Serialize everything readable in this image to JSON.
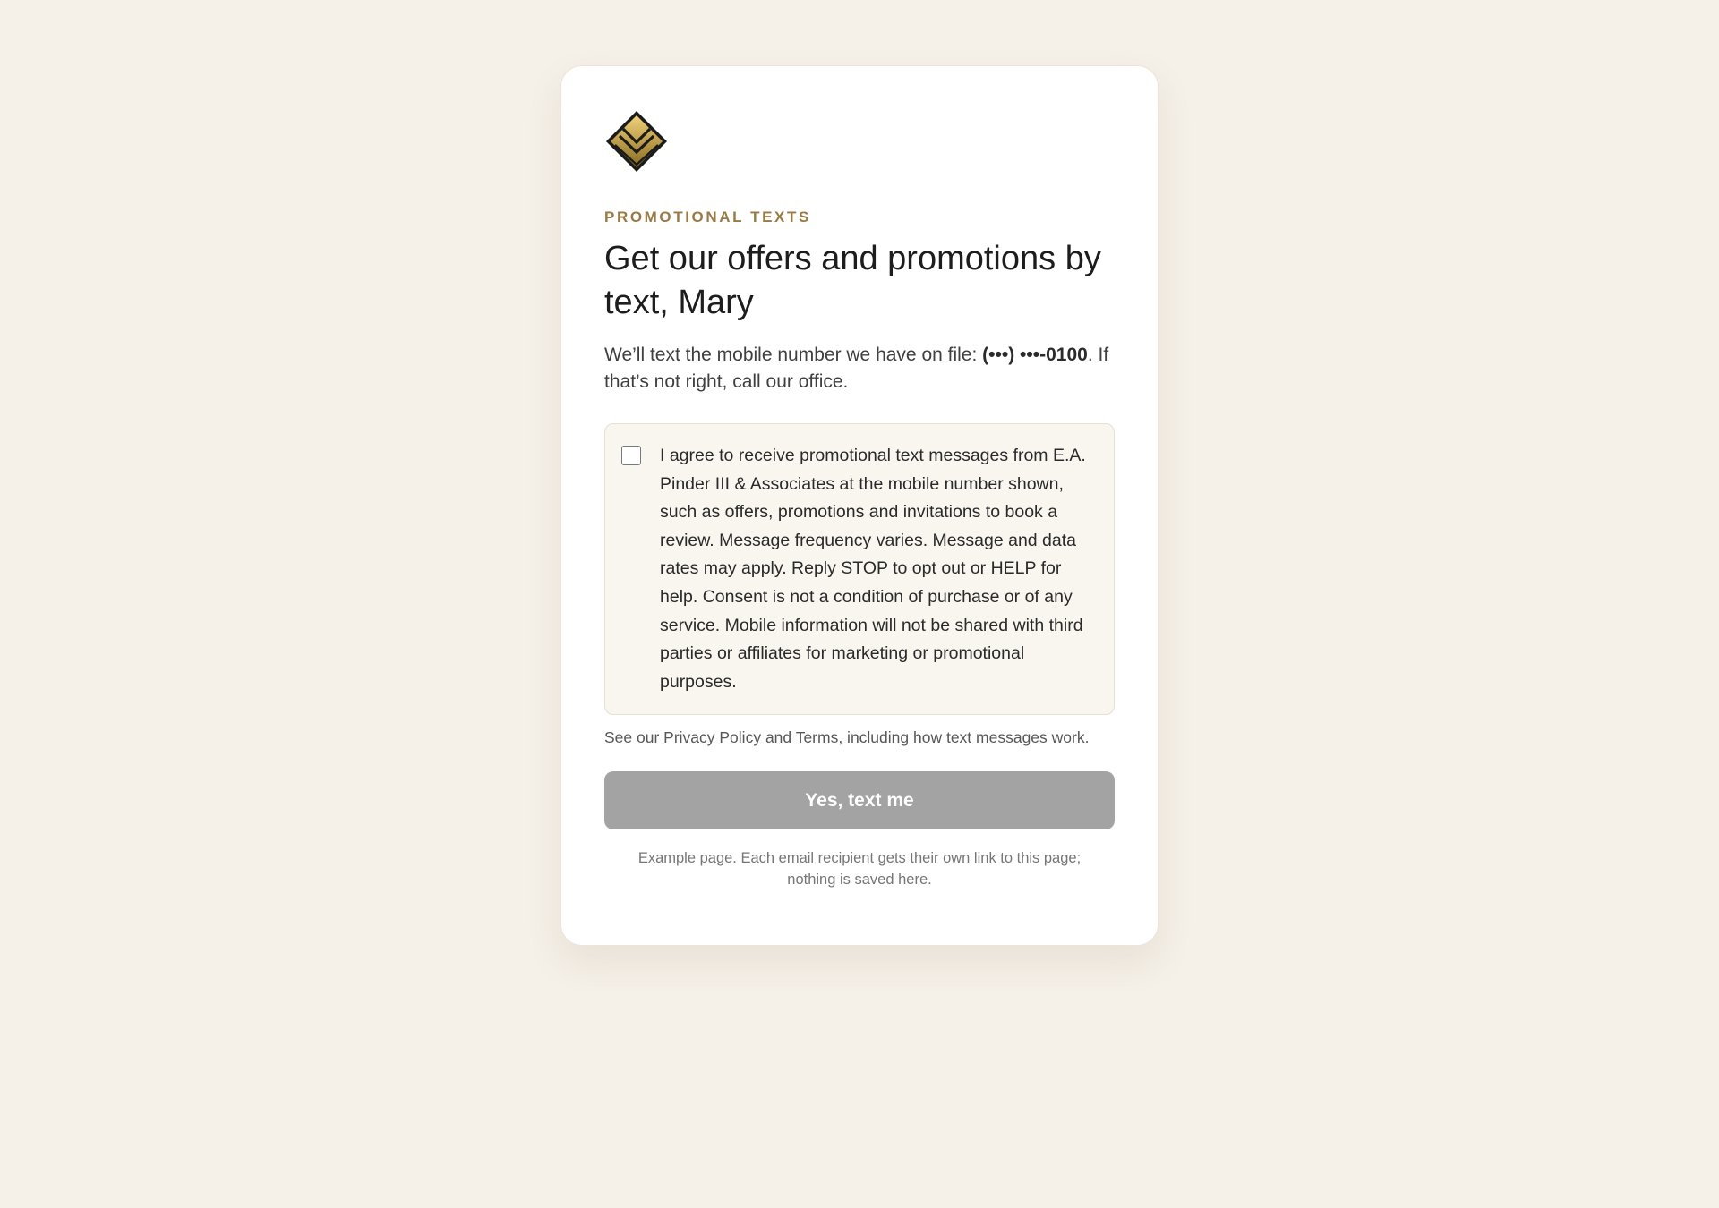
{
  "brand": {
    "logo_icon": "gold-diamond-chevron-logo",
    "accent_color": "#9a7a44",
    "gold_light": "#f1d27a",
    "gold_dark": "#8a6a1e"
  },
  "header": {
    "eyebrow": "PROMOTIONAL TEXTS",
    "headline": "Get our offers and promotions by text, Mary"
  },
  "intro": {
    "prefix": "We’ll text the mobile number we have on file: ",
    "phone_masked": "(•••) •••-0100",
    "suffix": ". If that’s not right, call our office."
  },
  "consent": {
    "checked": false,
    "text": "I agree to receive promotional text messages from E.A. Pinder III & Associates at the mobile number shown, such as offers, promotions and invitations to book a review. Message frequency varies. Message and data rates may apply. Reply STOP to opt out or HELP for help. Consent is not a condition of purchase or of any service. Mobile information will not be shared with third parties or affiliates for marketing or promotional purposes."
  },
  "legal": {
    "prefix": "See our ",
    "privacy_label": "Privacy Policy",
    "middle": " and ",
    "terms_label": "Terms",
    "suffix": ", including how text messages work."
  },
  "cta": {
    "label": "Yes, text me",
    "disabled": true,
    "disabled_color": "#a3a3a3"
  },
  "footnote": "Example page. Each email recipient gets their own link to this page; nothing is saved here."
}
